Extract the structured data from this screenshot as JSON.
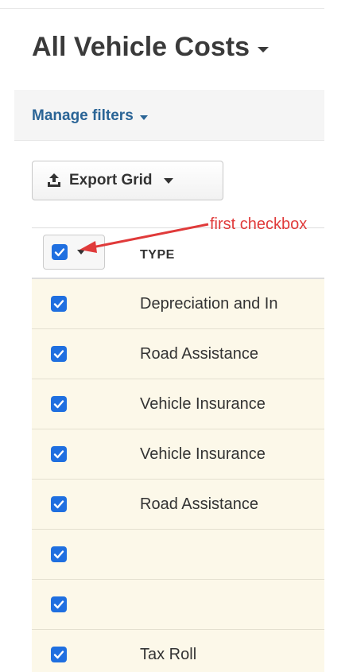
{
  "header": {
    "title": "All Vehicle Costs"
  },
  "filters": {
    "manage_label": "Manage filters"
  },
  "toolbar": {
    "export_label": "Export Grid"
  },
  "annotation": {
    "text": "first checkbox",
    "color": "#e03a3a"
  },
  "grid": {
    "columns": [
      "TYPE"
    ],
    "header_checked": true,
    "rows": [
      {
        "type": "Depreciation and In",
        "checked": true
      },
      {
        "type": "Road Assistance",
        "checked": true
      },
      {
        "type": "Vehicle Insurance",
        "checked": true
      },
      {
        "type": "Vehicle Insurance",
        "checked": true
      },
      {
        "type": "Road Assistance",
        "checked": true
      },
      {
        "type": "",
        "checked": true
      },
      {
        "type": "",
        "checked": true
      },
      {
        "type": "Tax Roll",
        "checked": true
      }
    ]
  },
  "colors": {
    "checkbox": "#1f6fe0",
    "link": "#2a6496",
    "row_background": "#fcf8e9"
  },
  "icons": {
    "title_caret": "caret-down-icon",
    "filters_caret": "caret-down-icon",
    "export": "upload-icon",
    "export_caret": "caret-down-icon",
    "checkbox": "checkmark-icon"
  }
}
